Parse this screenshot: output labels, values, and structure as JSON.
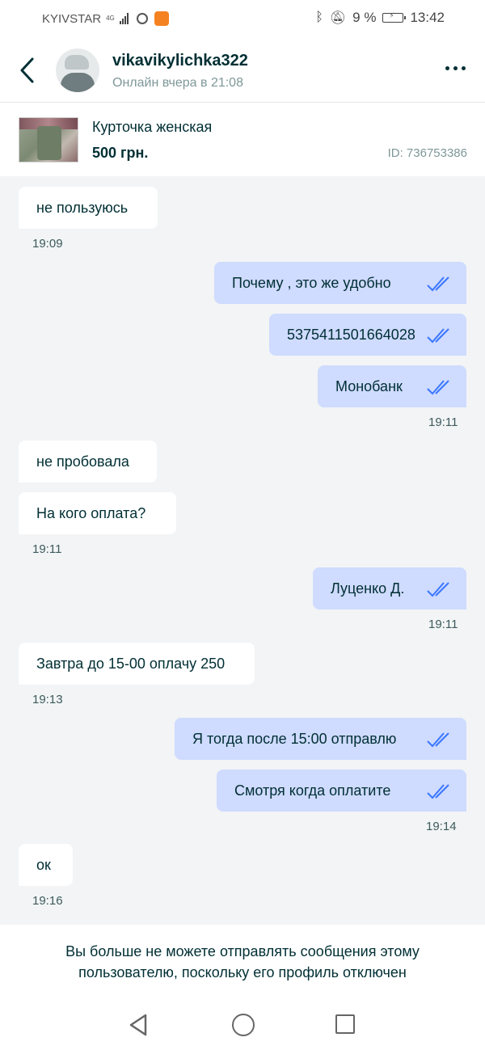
{
  "status_bar": {
    "carrier": "KYIVSTAR",
    "network": "4G",
    "battery_percent": "9 %",
    "time": "13:42"
  },
  "header": {
    "username": "vikavikylichka322",
    "status": "Онлайн вчера в 21:08"
  },
  "product": {
    "title": "Курточка женская",
    "price": "500 грн.",
    "id": "ID: 736753386"
  },
  "messages": [
    {
      "text": "не пользуюсь"
    },
    {
      "text": "Почему , это же удобно"
    },
    {
      "text": "5375411501664028"
    },
    {
      "text": "Монобанк"
    },
    {
      "text": "не пробовала"
    },
    {
      "text": "На кого оплата?"
    },
    {
      "text": "Луценко Д."
    },
    {
      "text": "Завтра до 15-00 оплачу 250"
    },
    {
      "text": "Я тогда после 15:00 отправлю"
    },
    {
      "text": "Смотря когда оплатите"
    },
    {
      "text": "ок"
    }
  ],
  "times": [
    "19:09",
    "19:11",
    "19:11",
    "19:11",
    "19:13",
    "19:14",
    "19:16"
  ],
  "footer": {
    "blocked_notice": "Вы больше не можете отправлять сообщения этому пользователю, поскольку его профиль отключен"
  },
  "colors": {
    "outgoing_bubble": "#cfdbff",
    "incoming_bubble": "#ffffff",
    "chat_background": "#f2f4f5",
    "read_tick": "#3a77ff",
    "text_primary": "#002f34"
  }
}
